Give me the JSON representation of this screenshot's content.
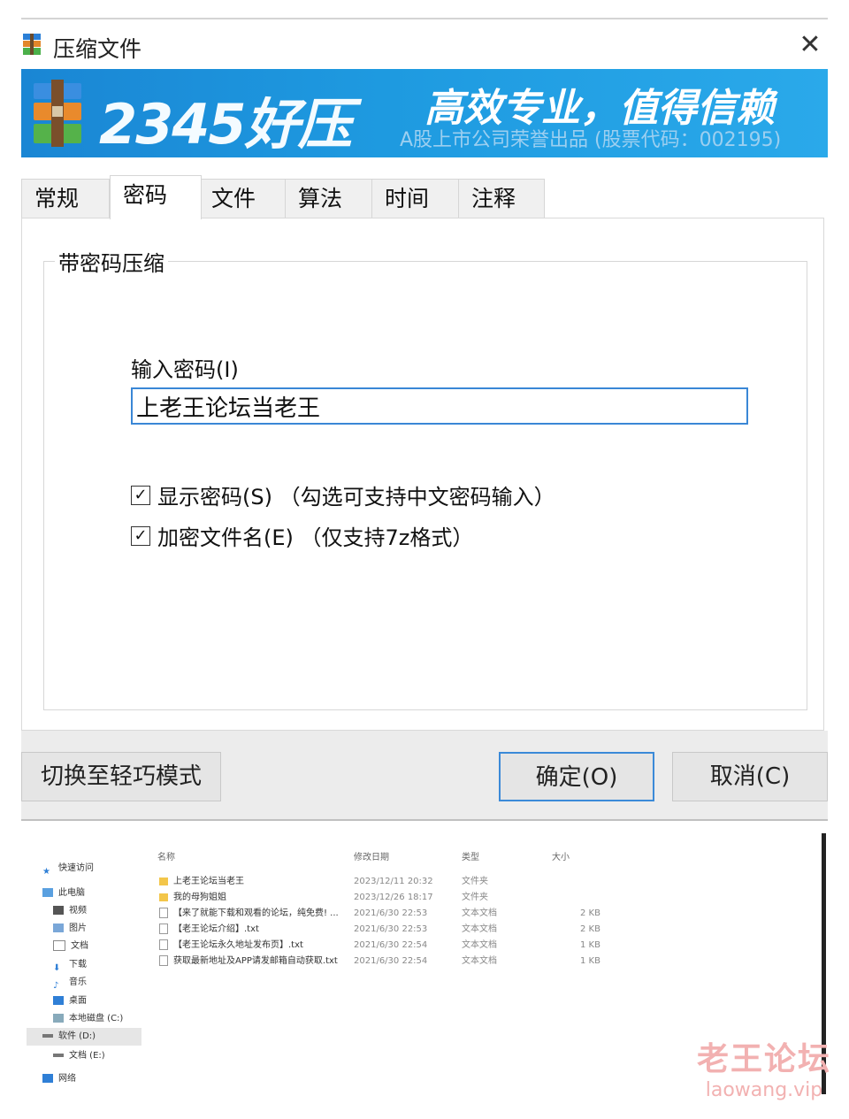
{
  "window": {
    "title": "压缩文件",
    "close_glyph": "✕"
  },
  "banner": {
    "brand": "2345好压",
    "slogan": "高效专业，值得信赖",
    "subtitle": "A股上市公司荣誉出品 (股票代码：002195)"
  },
  "tabs": [
    {
      "label": "常规",
      "active": false
    },
    {
      "label": "密码",
      "active": true
    },
    {
      "label": "文件",
      "active": false
    },
    {
      "label": "算法",
      "active": false
    },
    {
      "label": "时间",
      "active": false
    },
    {
      "label": "注释",
      "active": false
    }
  ],
  "password": {
    "group_title": "带密码压缩",
    "label": "输入密码(I)",
    "value": "上老王论坛当老王",
    "show_password": {
      "label": "显示密码(S) （勾选可支持中文密码输入）",
      "checked": true
    },
    "encrypt_names": {
      "label": "加密文件名(E) （仅支持7z格式）",
      "checked": true
    }
  },
  "buttons": {
    "switch_mode": "切换至轻巧模式",
    "ok": "确定(O)",
    "cancel": "取消(C)"
  },
  "explorer": {
    "nav": [
      "快速访问",
      "此电脑",
      "视频",
      "图片",
      "文档",
      "下载",
      "音乐",
      "桌面",
      "本地磁盘 (C:)",
      "软件 (D:)",
      "文档 (E:)",
      "网络"
    ],
    "selected_nav": "软件 (D:)",
    "columns": {
      "name": "名称",
      "date": "修改日期",
      "type": "类型",
      "size": "大小"
    },
    "rows": [
      {
        "name": "上老王论坛当老王",
        "date": "2023/12/11 20:32",
        "type": "文件夹",
        "size": "",
        "kind": "folder"
      },
      {
        "name": "我的母狗姐姐",
        "date": "2023/12/26 18:17",
        "type": "文件夹",
        "size": "",
        "kind": "folder"
      },
      {
        "name": "【来了就能下载和观看的论坛，纯免费! ...",
        "date": "2021/6/30 22:53",
        "type": "文本文档",
        "size": "2 KB",
        "kind": "file"
      },
      {
        "name": "【老王论坛介绍】.txt",
        "date": "2021/6/30 22:53",
        "type": "文本文档",
        "size": "2 KB",
        "kind": "file"
      },
      {
        "name": "【老王论坛永久地址发布页】.txt",
        "date": "2021/6/30 22:54",
        "type": "文本文档",
        "size": "1 KB",
        "kind": "file"
      },
      {
        "name": "获取最新地址及APP请发邮箱自动获取.txt",
        "date": "2021/6/30 22:54",
        "type": "文本文档",
        "size": "1 KB",
        "kind": "file"
      }
    ]
  },
  "watermark": {
    "line1": "老王论坛",
    "line2": "laowang.vip"
  },
  "colors": {
    "accent": "#3a87d6",
    "banner": "#1e9ae0",
    "folder": "#f3c64a"
  }
}
